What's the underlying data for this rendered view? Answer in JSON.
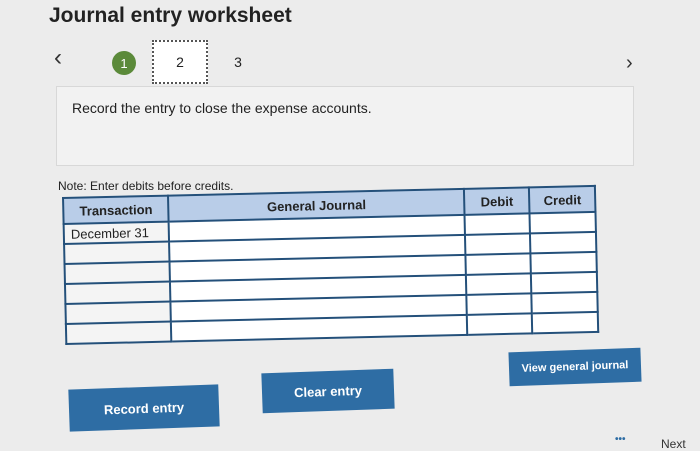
{
  "page": {
    "title": "Journal entry worksheet",
    "instruction": "Record the entry to close the expense accounts.",
    "note": "Note: Enter debits before credits."
  },
  "stepper": {
    "prev_icon": "chevron-left-icon",
    "next_icon": "chevron-right-icon",
    "steps": [
      "1",
      "2",
      "3"
    ],
    "active_step": "2"
  },
  "journal": {
    "headers": {
      "transaction": "Transaction",
      "general_journal": "General Journal",
      "debit": "Debit",
      "credit": "Credit"
    },
    "rows": [
      {
        "transaction": "December 31",
        "account": "",
        "debit": "",
        "credit": ""
      },
      {
        "transaction": "",
        "account": "",
        "debit": "",
        "credit": ""
      },
      {
        "transaction": "",
        "account": "",
        "debit": "",
        "credit": ""
      },
      {
        "transaction": "",
        "account": "",
        "debit": "",
        "credit": ""
      },
      {
        "transaction": "",
        "account": "",
        "debit": "",
        "credit": ""
      },
      {
        "transaction": "",
        "account": "",
        "debit": "",
        "credit": ""
      }
    ]
  },
  "buttons": {
    "record": "Record entry",
    "clear": "Clear entry",
    "view": "View general journal",
    "next": "Next",
    "dots": "•••"
  },
  "colors": {
    "button": "#2e6da4",
    "header_bg": "#b9cde8",
    "step_done": "#5b8a3a"
  }
}
